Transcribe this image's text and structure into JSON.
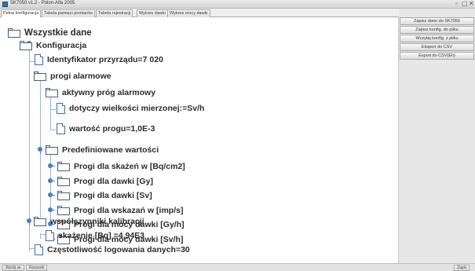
{
  "window": {
    "title": "SK7050 v1.2 - Polon-Alfa 2005",
    "minimize_glyph": "▫",
    "maximize_glyph": "▢",
    "close_glyph": "✕"
  },
  "tabs": [
    {
      "label": "Pełna konfiguracja",
      "active": true
    },
    {
      "label": "Tabela pamięci pomiarów",
      "active": false
    },
    {
      "label": "Tabela rejestracji",
      "active": false
    },
    {
      "label": "Wykres dawki",
      "active": false
    },
    {
      "label": "Wykres mocy dawki",
      "active": false
    }
  ],
  "tree": {
    "root": "Wszystkie dane",
    "konfiguracja": "Konfiguracja",
    "identyfikator": "Identyfikator przyrządu=7 020",
    "progi_alarmowe": "progi alarmowe",
    "aktywny_prog": "aktywny próg alarmowy",
    "dotyczy": "dotyczy wielkości mierzonej:=Sv/h",
    "wartosc_progu": "wartość progu=1,0E-3",
    "predefiniowane": "Predefiniowane wartości",
    "skazen": "Progi dla skażeń w [Bq/cm2]",
    "dawki_gy": "Progi dla dawki [Gy]",
    "dawki_sv": "Progi dla dawki [Sv]",
    "wskazan": "Progi dla wskazań w [imp/s]",
    "mocy_gyh": "Progi dla mocy dawki [Gy/h]",
    "mocy_svh": "Progi dla mocy dawki [Sv/h]",
    "wspolczynniki": "współczynniki kalibracji",
    "skazenie": "skażenie [Bq] =4,94E3",
    "czestotliwosc": "Częstotliwość logowania danych=30"
  },
  "side_buttons": [
    "Zapisz dane do SK7050",
    "Zapisz konfig. do pliku",
    "Wczytaj konfig. z pliku",
    "Eksport do CSV",
    "Export do CSV(Eh)"
  ],
  "status_buttons": [
    "Wyślij se",
    "Rozszeb",
    "Zapis"
  ],
  "colors": {
    "tree_line": "#9cb4d8",
    "toggle": "#4b7fc0",
    "folder": "#4a5e78",
    "file": "#3f6ca8"
  }
}
